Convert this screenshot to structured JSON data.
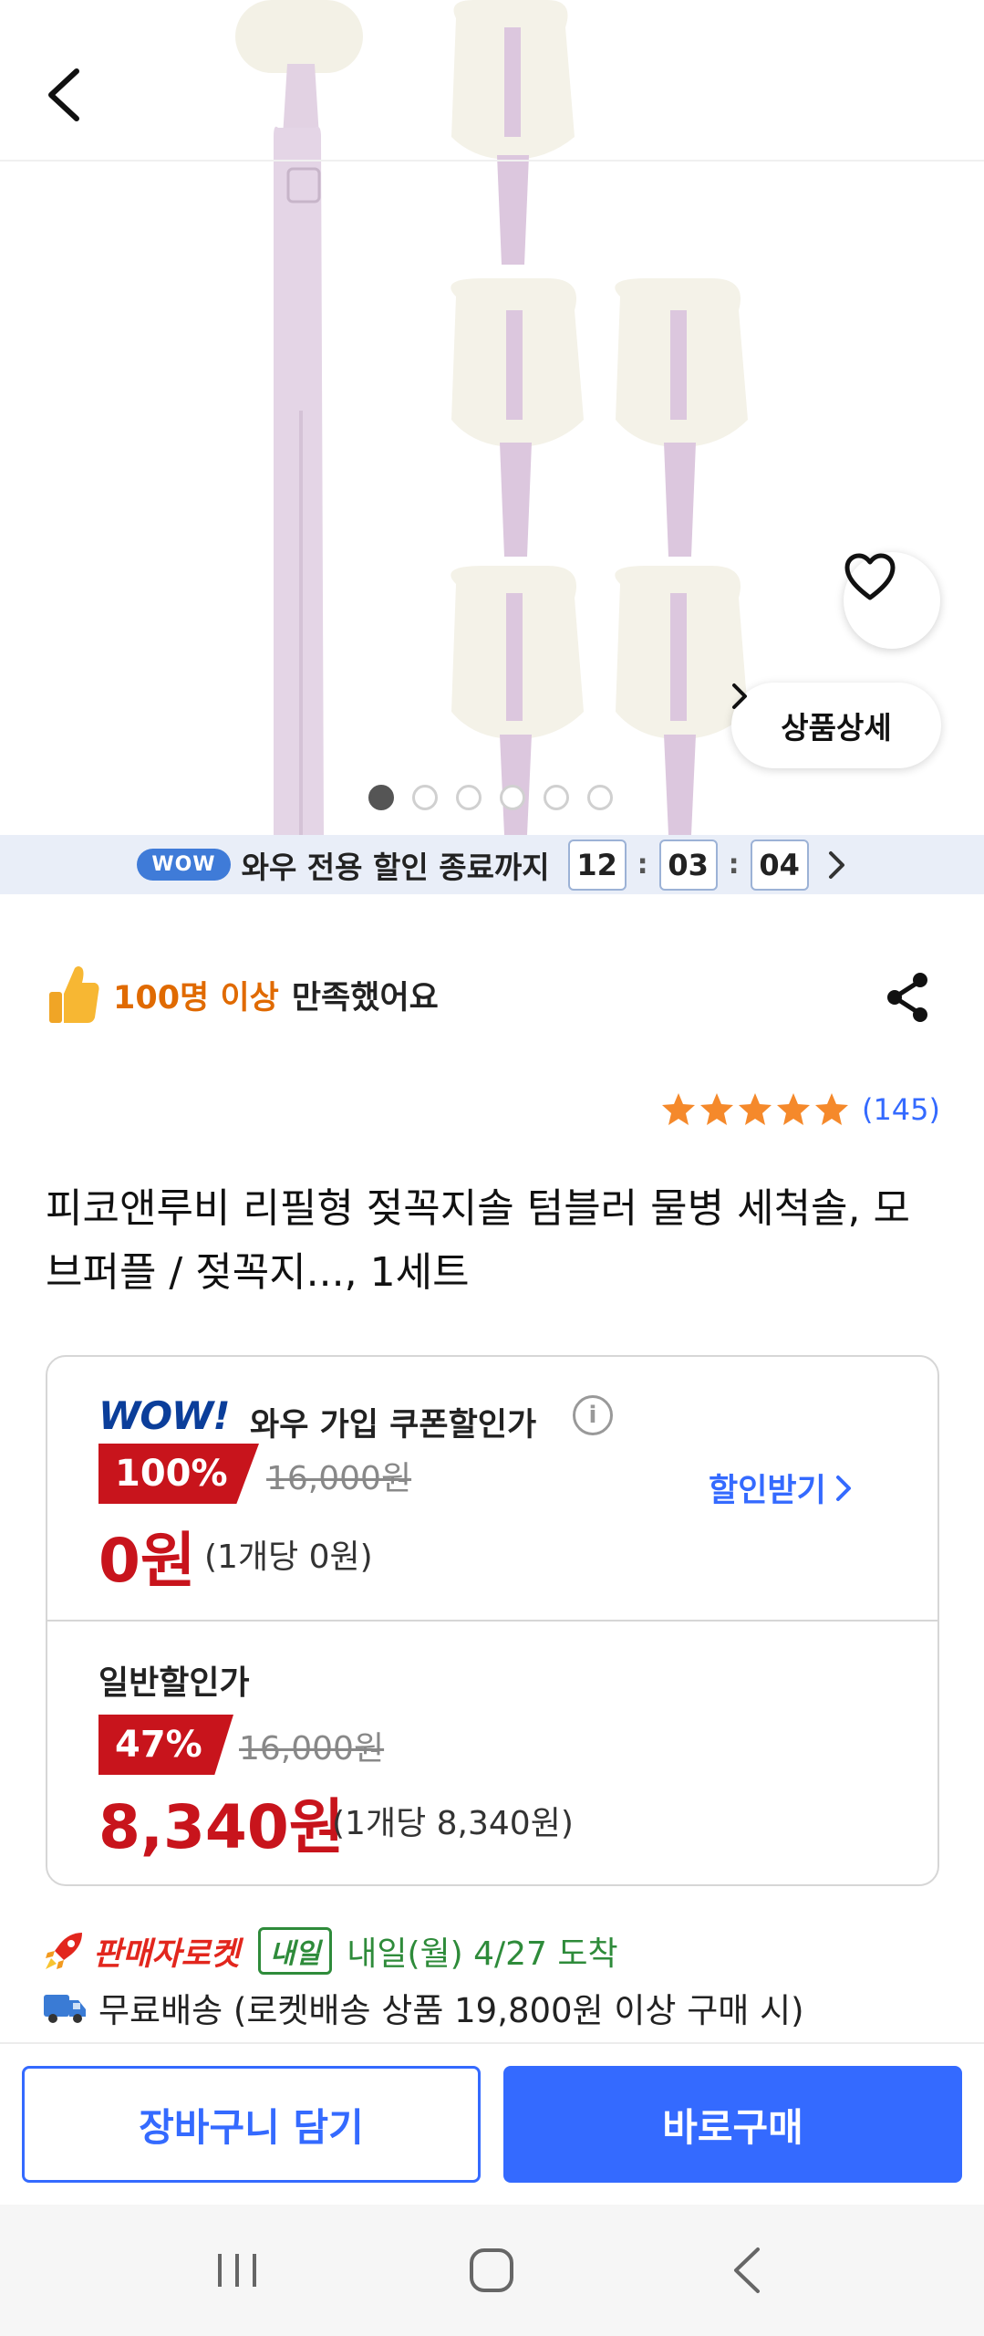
{
  "hero": {
    "back_icon": "chevron-left-icon",
    "wishlist_icon": "heart-outline-icon",
    "detail_button_label": "상품상세",
    "detail_button_icon": "chevron-right-icon",
    "carousel": {
      "total_pages": 6,
      "active_index": 0
    }
  },
  "wow_banner": {
    "pill": "WOW",
    "text": "와우 전용 할인 종료까지",
    "hours": "12",
    "minutes": "03",
    "seconds": "04",
    "sep": ":",
    "arrow_icon": "chevron-right-icon"
  },
  "satisfaction": {
    "icon": "thumbs-up-icon",
    "highlight": "100명 이상",
    "text": "만족했어요"
  },
  "share_icon": "share-icon",
  "rating": {
    "stars": 5,
    "count": "(145)",
    "star_color": "#f5892b"
  },
  "product_title": "피코앤루비 리필형 젖꼭지솔 텀블러 물병 세척솔, 모브퍼플 / 젖꼭지..., 1세트",
  "wow_price": {
    "logo": "WOW!",
    "label": "와우 가입 쿠폰할인가",
    "info_icon": "i",
    "discount": "100%",
    "original": "16,000원",
    "price": "0원",
    "unit_price": "(1개당 0원)",
    "claim_label": "할인받기"
  },
  "normal_price": {
    "label": "일반할인가",
    "discount": "47%",
    "original": "16,000원",
    "price": "8,340원",
    "unit_price": "(1개당 8,340원)"
  },
  "shipping": {
    "rocket_icon": "rocket-icon",
    "rocket_label": "판매자로켓",
    "tomorrow_badge": "내일",
    "arrival": "내일(월) 4/27 도착",
    "truck_icon": "truck-icon",
    "free_shipping": "무료배송 (로켓배송 상품 19,800원 이상 구매 시)"
  },
  "actions": {
    "cart_label": "장바구니 담기",
    "buy_label": "바로구매"
  },
  "system_nav": {
    "recents_icon": "recents-icon",
    "home_icon": "home-icon",
    "back_icon": "back-icon"
  },
  "colors": {
    "accent_blue": "#346aff",
    "price_red": "#c8141c",
    "wow_navy": "#0b3e9a",
    "rocket_red": "#e2261d",
    "delivery_green": "#2e8b3a",
    "satisfaction_orange": "#e06a00"
  }
}
